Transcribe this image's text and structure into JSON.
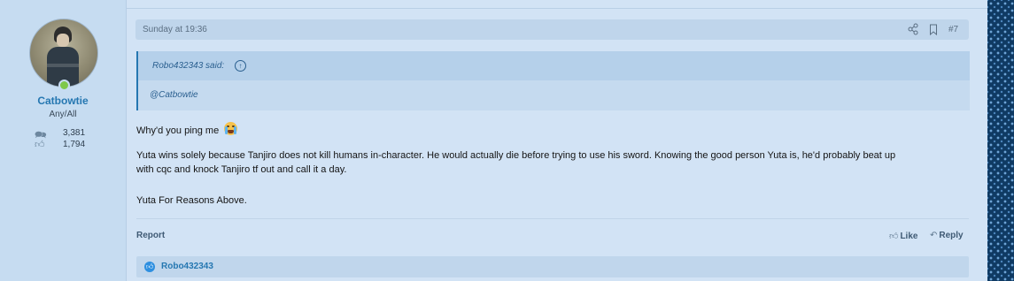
{
  "user": {
    "name": "Catbowtie",
    "title": "Any/All",
    "messages_count": "3,381",
    "reactions_count": "1,794",
    "messages_icon": "speech-bubbles-icon",
    "reactions_icon": "thumbs-up-icon",
    "online": true
  },
  "post": {
    "date": "Sunday at 19:36",
    "number": "#7",
    "quote": {
      "author_label": "Robo432343 said:",
      "body": "@Catbowtie"
    },
    "paragraphs": [
      "Why'd you ping me",
      "Yuta wins solely because Tanjiro does not kill humans in-character. He would actually die before trying to use his sword. Knowing the good person Yuta is, he'd probably beat up",
      "with cqc and knock Tanjiro tf out and call it a day.",
      "Yuta For Reasons Above."
    ],
    "emoji": "loudly-crying-face-icon"
  },
  "footer": {
    "report": "Report",
    "like": "Like",
    "reply": "Reply"
  },
  "reactions": {
    "users": "Robo432343"
  },
  "colors": {
    "accent": "#2577b1",
    "background": "#d2e3f5",
    "user_cell": "#c6dcf1",
    "online": "#7ec84b"
  }
}
